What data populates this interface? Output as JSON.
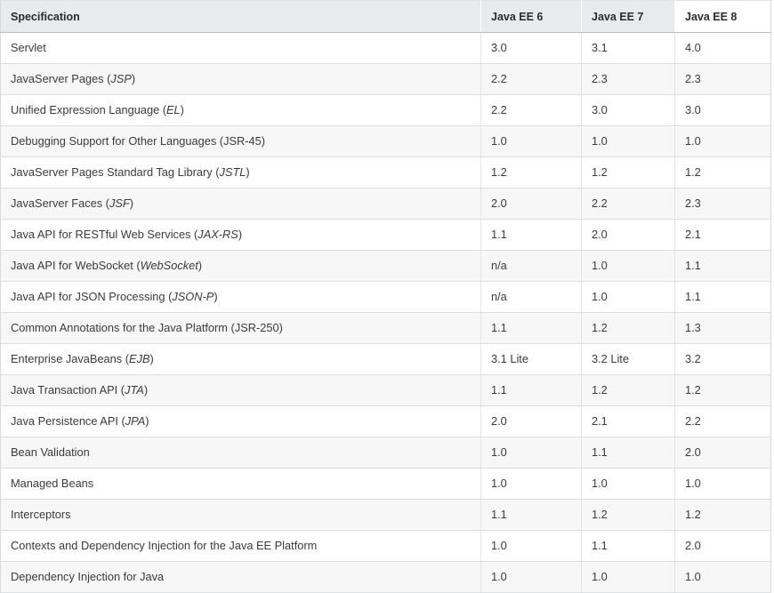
{
  "table": {
    "name": "java-ee-specifications-comparison",
    "columns": [
      {
        "key": "spec",
        "label": "Specification",
        "align": "left"
      },
      {
        "key": "ee6",
        "label": "Java EE 6",
        "align": "left"
      },
      {
        "key": "ee7",
        "label": "Java EE 7",
        "align": "left"
      },
      {
        "key": "ee8",
        "label": "Java EE 8",
        "align": "left"
      }
    ],
    "rows": [
      {
        "spec": "Servlet",
        "spec_plain": "Servlet",
        "abbr": "",
        "abbr_italic": false,
        "ee6": "3.0",
        "ee7": "3.1",
        "ee8": "4.0"
      },
      {
        "spec": "JavaServer Pages",
        "spec_plain": "JavaServer Pages",
        "abbr": "JSP",
        "abbr_italic": true,
        "ee6": "2.2",
        "ee7": "2.3",
        "ee8": "2.3"
      },
      {
        "spec": "Unified Expression Language",
        "spec_plain": "Unified Expression Language",
        "abbr": "EL",
        "abbr_italic": true,
        "ee6": "2.2",
        "ee7": "3.0",
        "ee8": "3.0"
      },
      {
        "spec": "Debugging Support for Other Languages",
        "spec_plain": "Debugging Support for Other Languages",
        "abbr": "JSR-45",
        "abbr_italic": false,
        "ee6": "1.0",
        "ee7": "1.0",
        "ee8": "1.0"
      },
      {
        "spec": "JavaServer Pages Standard Tag Library",
        "spec_plain": "JavaServer Pages Standard Tag Library",
        "abbr": "JSTL",
        "abbr_italic": true,
        "ee6": "1.2",
        "ee7": "1.2",
        "ee8": "1.2"
      },
      {
        "spec": "JavaServer Faces",
        "spec_plain": "JavaServer Faces",
        "abbr": "JSF",
        "abbr_italic": true,
        "ee6": "2.0",
        "ee7": "2.2",
        "ee8": "2.3"
      },
      {
        "spec": "Java API for RESTful Web Services",
        "spec_plain": "Java API for RESTful Web Services",
        "abbr": "JAX-RS",
        "abbr_italic": true,
        "ee6": "1.1",
        "ee7": "2.0",
        "ee8": "2.1"
      },
      {
        "spec": "Java API for WebSocket",
        "spec_plain": "Java API for WebSocket",
        "abbr": "WebSocket",
        "abbr_italic": true,
        "ee6": "n/a",
        "ee7": "1.0",
        "ee8": "1.1"
      },
      {
        "spec": "Java API for JSON Processing",
        "spec_plain": "Java API for JSON Processing",
        "abbr": "JSON-P",
        "abbr_italic": true,
        "ee6": "n/a",
        "ee7": "1.0",
        "ee8": "1.1"
      },
      {
        "spec": "Common Annotations for the Java Platform",
        "spec_plain": "Common Annotations for the Java Platform",
        "abbr": "JSR-250",
        "abbr_italic": false,
        "ee6": "1.1",
        "ee7": "1.2",
        "ee8": "1.3"
      },
      {
        "spec": "Enterprise JavaBeans",
        "spec_plain": "Enterprise JavaBeans",
        "abbr": "EJB",
        "abbr_italic": true,
        "ee6": "3.1 Lite",
        "ee7": "3.2 Lite",
        "ee8": "3.2"
      },
      {
        "spec": "Java Transaction API",
        "spec_plain": "Java Transaction API",
        "abbr": "JTA",
        "abbr_italic": true,
        "ee6": "1.1",
        "ee7": "1.2",
        "ee8": "1.2"
      },
      {
        "spec": "Java Persistence API",
        "spec_plain": "Java Persistence API",
        "abbr": "JPA",
        "abbr_italic": true,
        "ee6": "2.0",
        "ee7": "2.1",
        "ee8": "2.2"
      },
      {
        "spec": "Bean Validation",
        "spec_plain": "Bean Validation",
        "abbr": "",
        "abbr_italic": false,
        "ee6": "1.0",
        "ee7": "1.1",
        "ee8": "2.0"
      },
      {
        "spec": "Managed Beans",
        "spec_plain": "Managed Beans",
        "abbr": "",
        "abbr_italic": false,
        "ee6": "1.0",
        "ee7": "1.0",
        "ee8": "1.0"
      },
      {
        "spec": "Interceptors",
        "spec_plain": "Interceptors",
        "abbr": "",
        "abbr_italic": false,
        "ee6": "1.1",
        "ee7": "1.2",
        "ee8": "1.2"
      },
      {
        "spec": "Contexts and Dependency Injection for the Java EE Platform",
        "spec_plain": "Contexts and Dependency Injection for the Java EE Platform",
        "abbr": "",
        "abbr_italic": false,
        "ee6": "1.0",
        "ee7": "1.1",
        "ee8": "2.0"
      },
      {
        "spec": "Dependency Injection for Java",
        "spec_plain": "Dependency Injection for Java",
        "abbr": "",
        "abbr_italic": false,
        "ee6": "1.0",
        "ee7": "1.0",
        "ee8": "1.0"
      }
    ]
  },
  "colors": {
    "header_background": "#e9eaee",
    "header_text": "#2b2b2b",
    "row_odd_background": "#ffffff",
    "row_even_background": "#f7f7f8",
    "border": "#dcdde0",
    "body_text": "#3a3a3a"
  }
}
